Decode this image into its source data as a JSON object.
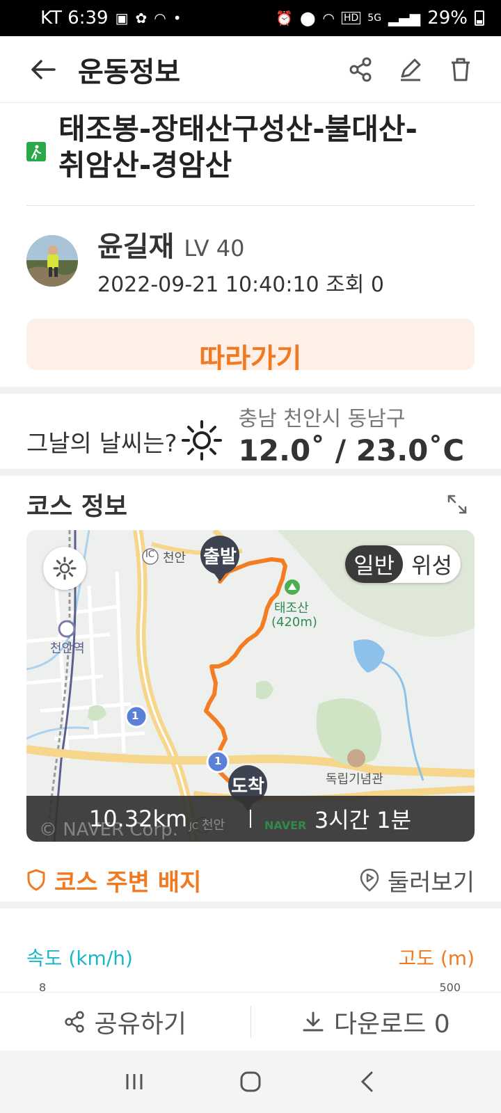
{
  "status_bar": {
    "carrier_time": "KT 6:39",
    "battery": "29%",
    "icons_left": [
      "gallery-icon",
      "share-icon",
      "wifi-icon",
      "dot-icon"
    ],
    "icons_right": [
      "alarm-icon",
      "location-icon",
      "wifi-icon",
      "hd-icon",
      "5g-icon",
      "signal-icon",
      "battery-icon"
    ]
  },
  "appbar": {
    "title": "운동정보",
    "icons": [
      "back-arrow-icon",
      "share-icon",
      "edit-icon",
      "trash-icon"
    ]
  },
  "route": {
    "name_line1": "태조봉-장태산구성산-불대산-",
    "name_line2": "취암산-경암산",
    "icon": "hiking-icon"
  },
  "author": {
    "name": "윤길재",
    "level": "LV 40",
    "meta": "2022-09-21 10:40:10 조회 0"
  },
  "follow_button": {
    "label": "따라가기"
  },
  "weather": {
    "label": "그날의 날씨는?",
    "location": "충남 천안시 동남구",
    "temperature": "12.0˚ / 23.0˚C",
    "icon": "sun-icon"
  },
  "course": {
    "title": "코스 정보",
    "map": {
      "toggle_on": "일반",
      "toggle_off": "위성",
      "start_label": "출발",
      "end_label": "도착",
      "places": {
        "cheonan_ic": "천안",
        "cheonan_station": "천안역",
        "taejosan": "태조산",
        "taejosan_height": "(420m)",
        "independence_hall": "독립기념관",
        "cheonan_jc": "천안",
        "route_1a": "1",
        "route_1b": "1",
        "ic": "IC",
        "jc": "JC",
        "naver_logo": "NAVER"
      },
      "distance": "10.32km",
      "duration": "3시간 1분",
      "copyright": "© NAVER Corp."
    }
  },
  "badge_row": {
    "badges_label": "코스 주변 배지",
    "around_label": "둘러보기"
  },
  "graph": {
    "speed_label": "속도 (km/h)",
    "altitude_label": "고도 (m)",
    "speed_top_tick": "8",
    "altitude_top_tick": "500"
  },
  "bottom_actions": {
    "share_label": "공유하기",
    "download_label": "다운로드 0"
  },
  "colors": {
    "accent_orange": "#f07a22",
    "speed_cyan": "#19b7c8",
    "route_orange": "#f47c22",
    "hike_green": "#2aa84a"
  }
}
